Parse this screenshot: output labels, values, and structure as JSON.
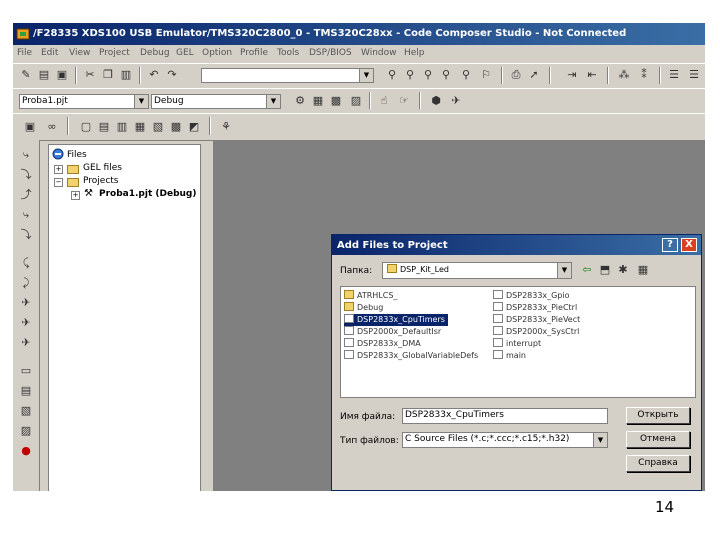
{
  "window": {
    "title": "/F28335 XDS100 USB Emulator/TMS320C2800_0 - TMS320C28xx - Code Composer Studio - Not Connected"
  },
  "menu": [
    "File",
    "Edit",
    "View",
    "Project",
    "Debug",
    "GEL",
    "Option",
    "Profile",
    "Tools",
    "DSP/BIOS",
    "Window",
    "Help"
  ],
  "toolbar2": {
    "project_combo": "Proba1.pjt",
    "config_combo": "Debug"
  },
  "tree": {
    "root": "Files",
    "gel": "GEL files",
    "projects": "Projects",
    "project": "Proba1.pjt (Debug)"
  },
  "dialog": {
    "title": "Add Files to Project",
    "look_in_label": "Папка:",
    "look_in_value": "DSP_Kit_Led",
    "files": [
      {
        "name": "ATRHLCS_",
        "kind": "folder",
        "selected": false
      },
      {
        "name": "Debug",
        "kind": "folder",
        "selected": false
      },
      {
        "name": "DSP2833x_CpuTimers",
        "kind": "file",
        "selected": true
      },
      {
        "name": "DSP2000x_DefaultIsr",
        "kind": "file",
        "selected": false
      },
      {
        "name": "DSP2833x_DMA",
        "kind": "file",
        "selected": false
      },
      {
        "name": "DSP2833x_GlobalVariableDefs",
        "kind": "file",
        "selected": false
      },
      {
        "name": "DSP2833x_Gpio",
        "kind": "file",
        "selected": false
      },
      {
        "name": "DSP2833x_PieCtrl",
        "kind": "file",
        "selected": false
      },
      {
        "name": "DSP2833x_PieVect",
        "kind": "file",
        "selected": false
      },
      {
        "name": "DSP2000x_SysCtrl",
        "kind": "file",
        "selected": false
      },
      {
        "name": "interrupt",
        "kind": "file",
        "selected": false
      },
      {
        "name": "main",
        "kind": "file",
        "selected": false
      }
    ],
    "filename_label": "Имя файла:",
    "filename_value": "DSP2833x_CpuTimers",
    "filetype_label": "Тип файлов:",
    "filetype_value": "C Source Files (*.c;*.ccc;*.c15;*.h32)",
    "open_button": "Открыть",
    "cancel_button": "Отмена",
    "help_button": "Справка",
    "help_title_button": "?",
    "close_title_button": "X"
  },
  "page_number": "14",
  "colors": {
    "titlebar": "#0a246a",
    "chrome": "#d4d0c8",
    "workspace": "#808080",
    "selection": "#0a246a"
  }
}
